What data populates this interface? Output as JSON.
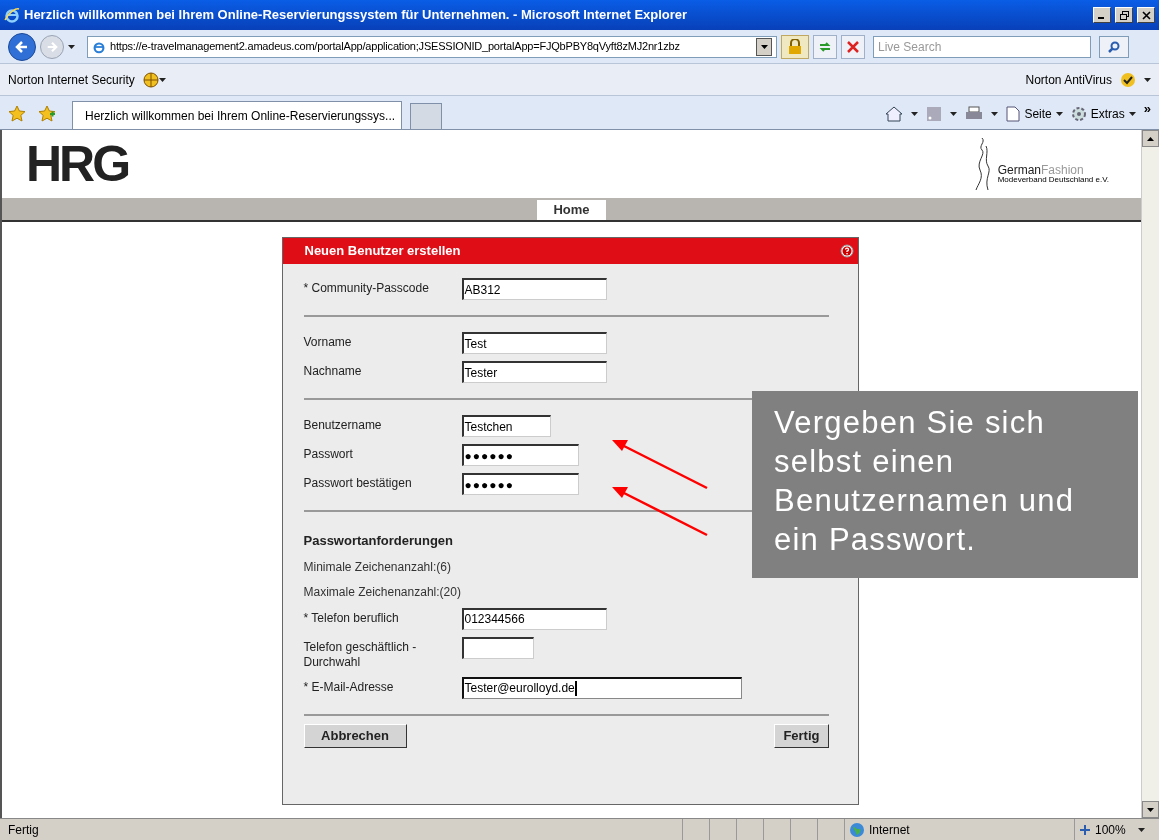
{
  "window": {
    "title": "Herzlich willkommen bei Ihrem Online-Reservierungssystem für Unternehmen. - Microsoft Internet Explorer"
  },
  "address_bar": {
    "url": "https://e-travelmanagement2.amadeus.com/portalApp/application;JSESSIONID_portalApp=FJQbPBY8qVyft8zMJ2nr1zbz",
    "search_placeholder": "Live Search"
  },
  "norton_bar": {
    "left": "Norton Internet Security",
    "right": "Norton AntiVirus"
  },
  "tab_bar": {
    "tabs": [
      {
        "label": "Herzlich willkommen bei Ihrem Online-Reservierungssys...",
        "selected": true
      }
    ],
    "commands": [
      "Seite",
      "Extras"
    ],
    "more": "»"
  },
  "page": {
    "logo": "HRG",
    "partner_logo": {
      "name_dark": "German",
      "name_light": "Fashion",
      "subtitle": "Modeverband Deutschland e.V."
    },
    "nav_tabs": [
      {
        "label": "Home",
        "selected": true
      }
    ],
    "form": {
      "title": "Neuen Benutzer erstellen",
      "sections": [
        [
          {
            "kind": "field",
            "label": "* Community-Passcode",
            "value": "AB312",
            "focused": false
          }
        ],
        [
          {
            "kind": "field",
            "label": "Vorname",
            "value": "Test",
            "focused": false
          },
          {
            "kind": "field",
            "label": "Nachname",
            "value": "Tester",
            "focused": false
          }
        ],
        [
          {
            "kind": "field",
            "label": "Benutzername",
            "value": "Testchen",
            "focused": false
          },
          {
            "kind": "password",
            "label": "Passwort",
            "value": "●●●●●●",
            "focused": false
          },
          {
            "kind": "password",
            "label": "Passwort bestätigen",
            "value": "●●●●●●",
            "focused": false
          }
        ],
        [
          {
            "kind": "heading",
            "label": "Passwortanforderungen"
          },
          {
            "kind": "note",
            "label": "Minimale Zeichenanzahl:(6)"
          },
          {
            "kind": "note",
            "label": "Maximale Zeichenanzahl:(20)"
          },
          {
            "kind": "field",
            "label": "* Telefon beruflich",
            "value": "012344566",
            "focused": false
          },
          {
            "kind": "field",
            "label": "Telefon geschäftlich - Durchwahl",
            "focused": false
          },
          {
            "kind": "field",
            "label": "* E-Mail-Adresse",
            "value": "Tester@eurolloyd.de",
            "focused": true
          }
        ]
      ],
      "buttons": [
        "Abbrechen",
        "Fertig"
      ]
    },
    "callout": "Vergeben Sie sich selbst einen Benutzernamen und ein Passwort."
  },
  "status_bar": {
    "text": "Fertig",
    "zone": "Internet",
    "zoom": "100%"
  }
}
